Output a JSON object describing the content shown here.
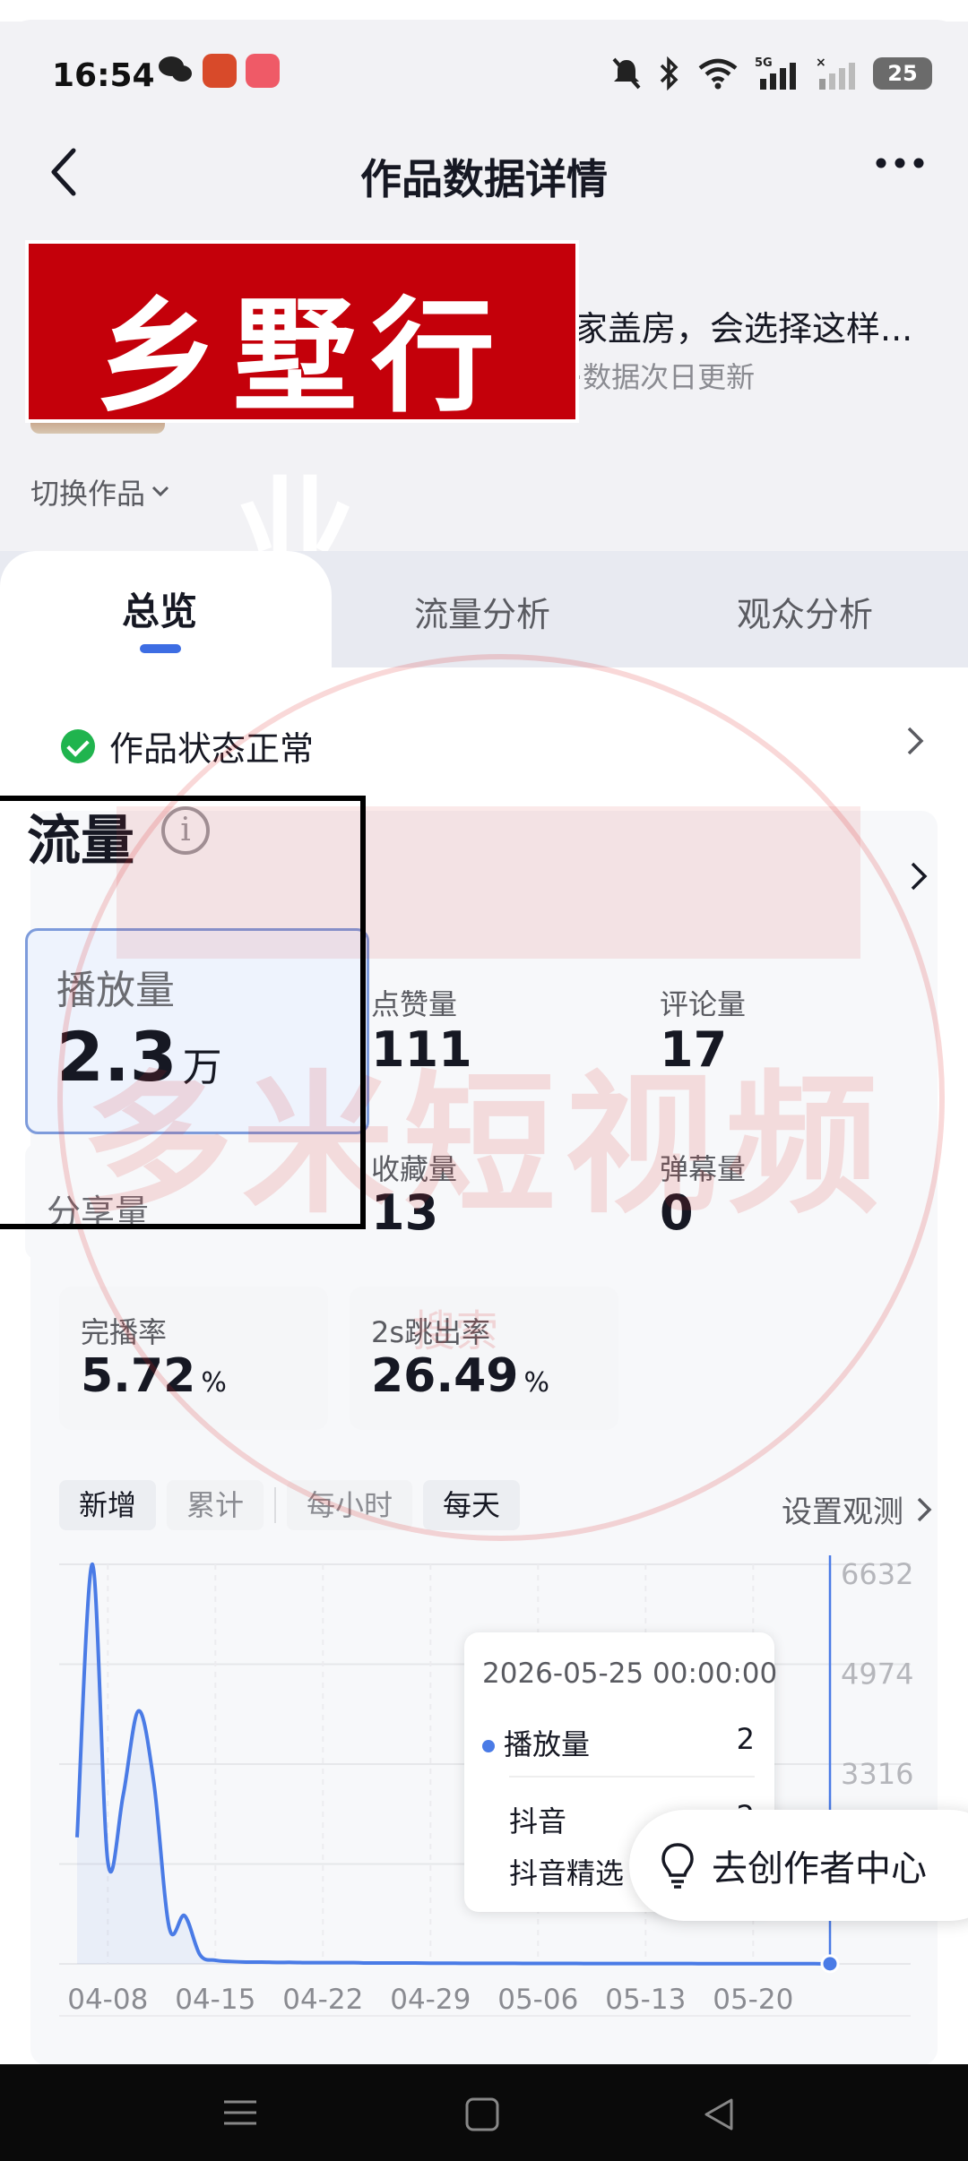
{
  "status_bar": {
    "time": "16:54",
    "battery": "25",
    "icons": [
      "wechat-icon",
      "app-icon",
      "app-icon",
      "mute-icon",
      "bluetooth-icon",
      "wifi-icon",
      "signal-5g-icon",
      "signal-icon",
      "battery-icon"
    ]
  },
  "header": {
    "title": "作品数据详情",
    "back_icon": "back-arrow-icon",
    "more_icon": "more-icon"
  },
  "work": {
    "banner_text": "乡墅行业",
    "title": "家盖房，会选择这样...",
    "subtitle": "·数据次日更新",
    "switch_label": "切换作品"
  },
  "tabs": [
    {
      "label": "总览",
      "active": true
    },
    {
      "label": "流量分析",
      "active": false
    },
    {
      "label": "观众分析",
      "active": false
    }
  ],
  "status_row": {
    "label": "作品状态正常"
  },
  "flow": {
    "title": "流量",
    "metrics": {
      "play": {
        "label": "播放量",
        "value": "2.3",
        "unit": "万"
      },
      "like": {
        "label": "点赞量",
        "value": "111"
      },
      "comment": {
        "label": "评论量",
        "value": "17"
      },
      "share": {
        "label": "分享量"
      },
      "favorite": {
        "label": "收藏量",
        "value": "13"
      },
      "danmu": {
        "label": "弹幕量",
        "value": "0"
      },
      "complete_rate": {
        "label": "完播率",
        "value": "5.72",
        "unit": "%"
      },
      "bounce_rate": {
        "label": "2s跳出率",
        "value": "26.49",
        "unit": "%"
      }
    }
  },
  "chips": {
    "new": "新增",
    "cumulative": "累计",
    "hourly": "每小时",
    "daily": "每天",
    "observe": "设置观测"
  },
  "chart_data": {
    "type": "line",
    "series": [
      {
        "name": "播放量",
        "color": "#4a7be6"
      }
    ],
    "x": [
      "04-06",
      "04-07",
      "04-08",
      "04-09",
      "04-10",
      "04-11",
      "04-12",
      "04-13",
      "04-14",
      "04-15",
      "04-16",
      "04-17",
      "04-18",
      "04-19",
      "04-20",
      "04-21",
      "04-22",
      "04-23",
      "04-24",
      "04-25",
      "04-26",
      "04-27",
      "04-28",
      "04-29",
      "04-30",
      "05-01",
      "05-02",
      "05-03",
      "05-04",
      "05-05",
      "05-06",
      "05-07",
      "05-08",
      "05-09",
      "05-10",
      "05-11",
      "05-12",
      "05-13",
      "05-14",
      "05-15",
      "05-16",
      "05-17",
      "05-18",
      "05-19",
      "05-20",
      "05-21",
      "05-22",
      "05-23",
      "05-24",
      "05-25"
    ],
    "values": [
      2100,
      6632,
      1700,
      2800,
      4200,
      3000,
      600,
      800,
      150,
      60,
      40,
      30,
      30,
      25,
      25,
      20,
      20,
      20,
      20,
      15,
      15,
      15,
      15,
      12,
      12,
      10,
      10,
      10,
      10,
      8,
      8,
      8,
      8,
      6,
      6,
      6,
      6,
      5,
      5,
      5,
      5,
      4,
      4,
      4,
      4,
      3,
      3,
      3,
      3,
      2
    ],
    "x_ticks": [
      "04-08",
      "04-15",
      "04-22",
      "04-29",
      "05-06",
      "05-13",
      "05-20"
    ],
    "y_ticks": [
      "6632",
      "4974",
      "3316"
    ],
    "ylim": [
      0,
      6632
    ]
  },
  "tooltip": {
    "date": "2026-05-25 00:00:00",
    "metric_label": "播放量",
    "metric_value": "2",
    "row2_label": "抖音",
    "row2_value": "2",
    "row3_label": "抖音精选"
  },
  "creator_button": {
    "label": "去创作者中心",
    "icon": "bulb-icon"
  },
  "watermark": {
    "text": "多米短视频",
    "sub": "搜索"
  },
  "colors": {
    "accent": "#3d6de3",
    "line": "#4a7be6",
    "ok": "#20b44e",
    "banner": "#c4000a"
  }
}
